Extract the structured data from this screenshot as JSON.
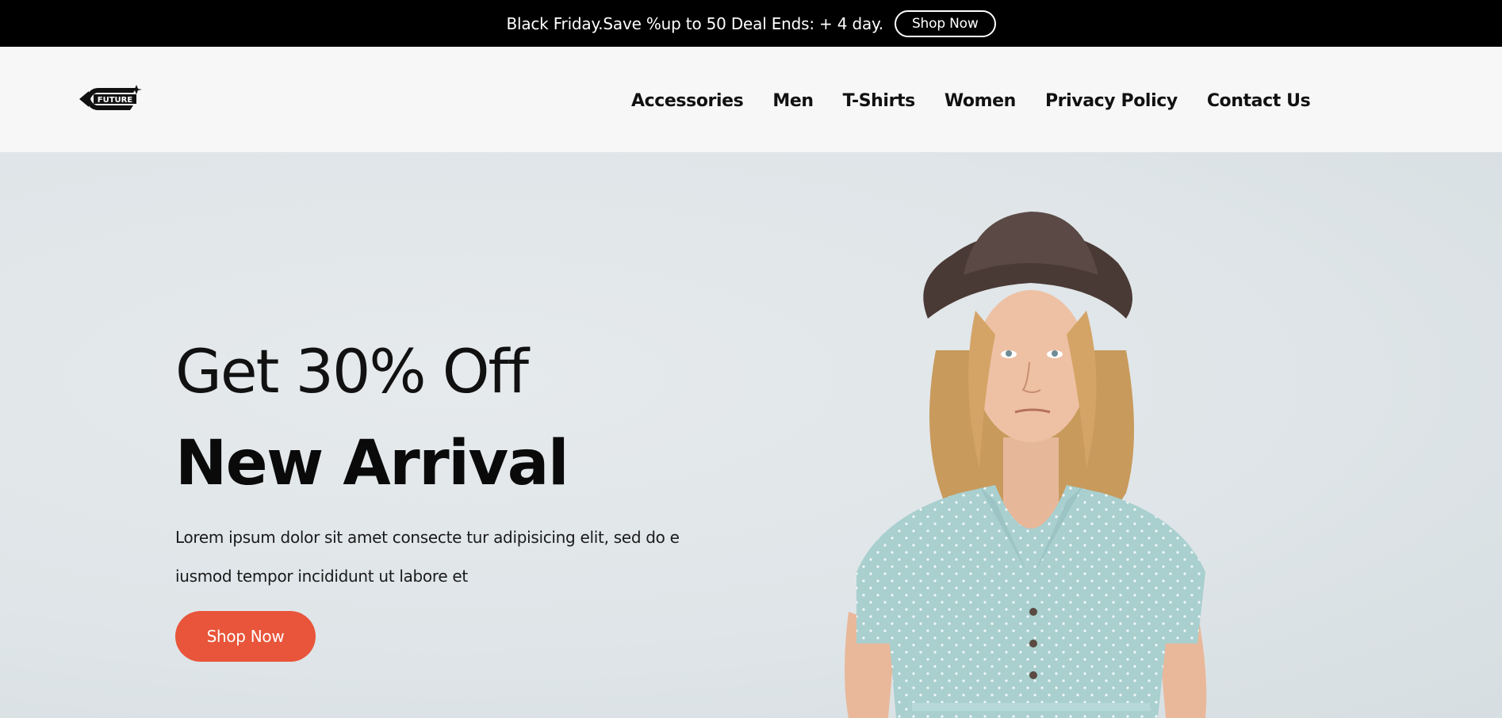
{
  "announcement": {
    "text": "Black Friday.Save %up to 50 Deal Ends: + 4 day.",
    "button_label": "Shop Now"
  },
  "header": {
    "logo_text": "FUTURE",
    "nav": [
      {
        "label": "Accessories"
      },
      {
        "label": "Men"
      },
      {
        "label": "T-Shirts"
      },
      {
        "label": "Women"
      },
      {
        "label": "Privacy Policy"
      },
      {
        "label": "Contact Us"
      }
    ]
  },
  "hero": {
    "subtitle": "Get 30% Off",
    "title": "New Arrival",
    "description": "Lorem ipsum dolor sit amet consecte tur adipisicing elit, sed do e iusmod tempor incididunt ut labore et",
    "button_label": "Shop Now"
  },
  "colors": {
    "topbar_bg": "#000000",
    "header_bg": "#f7f7f7",
    "hero_bg": "#e3e8ea",
    "accent": "#e8553a"
  }
}
